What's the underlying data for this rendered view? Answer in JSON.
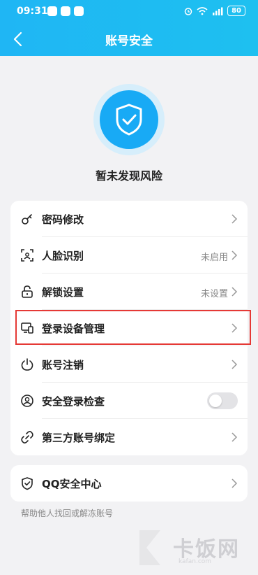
{
  "status_bar": {
    "time": "09:31",
    "battery": "80"
  },
  "header": {
    "title": "账号安全",
    "back": "返回"
  },
  "status": {
    "text": "暂未发现风险"
  },
  "settings": [
    {
      "label": "密码修改",
      "value": "",
      "icon": "key-icon"
    },
    {
      "label": "人脸识别",
      "value": "未启用",
      "icon": "face-scan-icon"
    },
    {
      "label": "解锁设置",
      "value": "未设置",
      "icon": "lock-icon"
    },
    {
      "label": "登录设备管理",
      "value": "",
      "icon": "devices-icon"
    },
    {
      "label": "账号注销",
      "value": "",
      "icon": "power-icon"
    },
    {
      "label": "安全登录检查",
      "value": "",
      "icon": "user-check-icon",
      "toggle": false
    },
    {
      "label": "第三方账号绑定",
      "value": "",
      "icon": "link-icon"
    }
  ],
  "qq_center": {
    "label": "QQ安全中心",
    "icon": "shield-check-icon"
  },
  "help": {
    "text": "帮助他人找回或解冻账号"
  },
  "watermark": {
    "text": "卡饭网",
    "sub": "kafan.com"
  },
  "colors": {
    "accent": "#18aaf5",
    "highlight": "#e53935"
  }
}
